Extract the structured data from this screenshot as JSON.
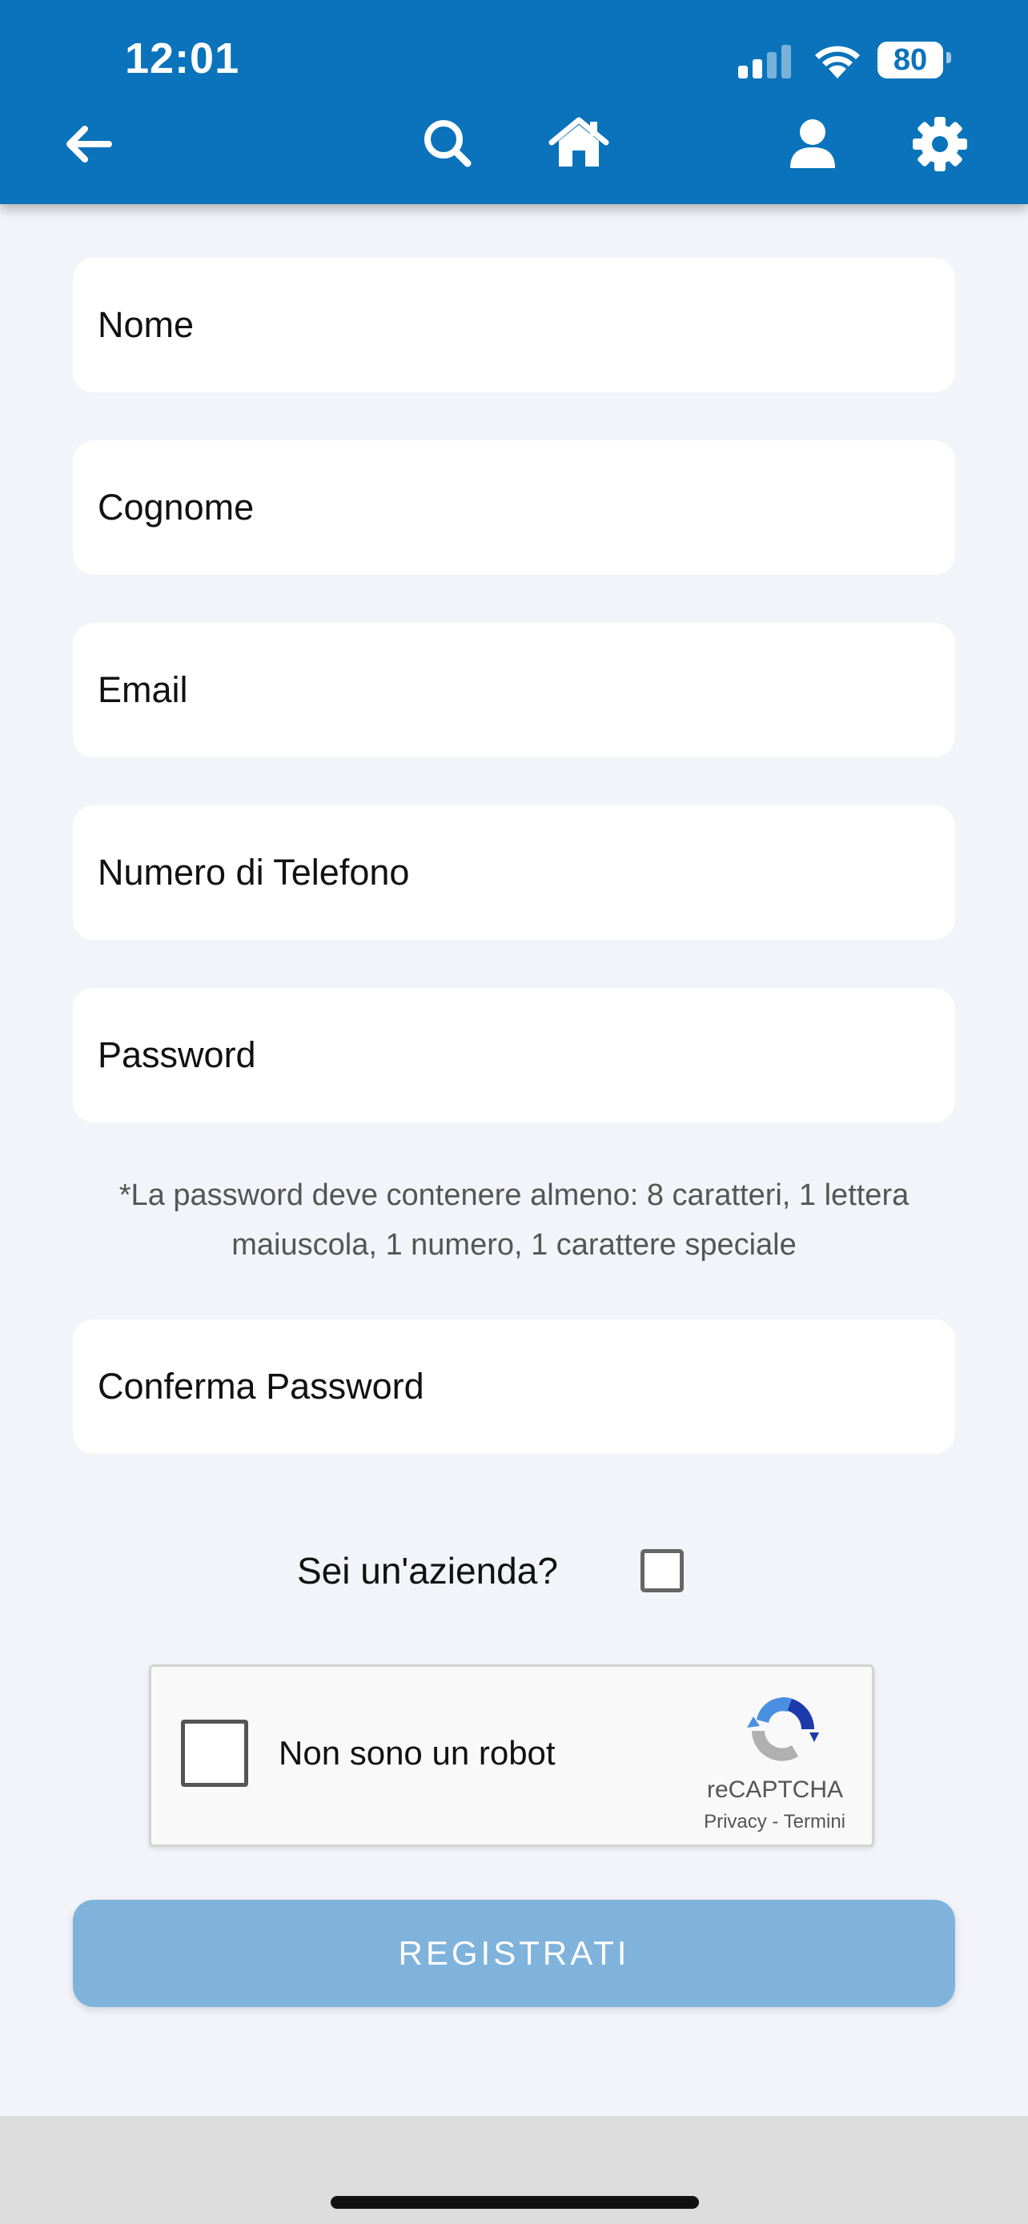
{
  "status_bar": {
    "time": "12:01",
    "battery": "80",
    "icons": [
      "signal-icon",
      "wifi-icon",
      "battery-icon"
    ]
  },
  "header": {
    "background_color": "#0a73bb",
    "icons": [
      "back-arrow-icon",
      "search-icon",
      "home-icon",
      "user-icon",
      "gear-icon"
    ]
  },
  "form": {
    "fields": [
      {
        "placeholder": "Nome",
        "value": ""
      },
      {
        "placeholder": "Cognome",
        "value": ""
      },
      {
        "placeholder": "Email",
        "value": ""
      },
      {
        "placeholder": "Numero di Telefono",
        "value": ""
      },
      {
        "placeholder": "Password",
        "value": ""
      },
      {
        "placeholder": "Conferma Password",
        "value": ""
      }
    ],
    "password_hint": "*La password deve contenere almeno: 8 caratteri, 1 lettera maiuscola, 1 numero, 1 carattere speciale",
    "company_label": "Sei un'azienda?",
    "company_checked": false
  },
  "recaptcha": {
    "label": "Non sono un robot",
    "brand": "reCAPTCHA",
    "privacy": "Privacy",
    "separator": " - ",
    "terms": "Termini",
    "checked": false
  },
  "register_button": {
    "label": "REGISTRATI",
    "color": "#7fb3dc"
  }
}
